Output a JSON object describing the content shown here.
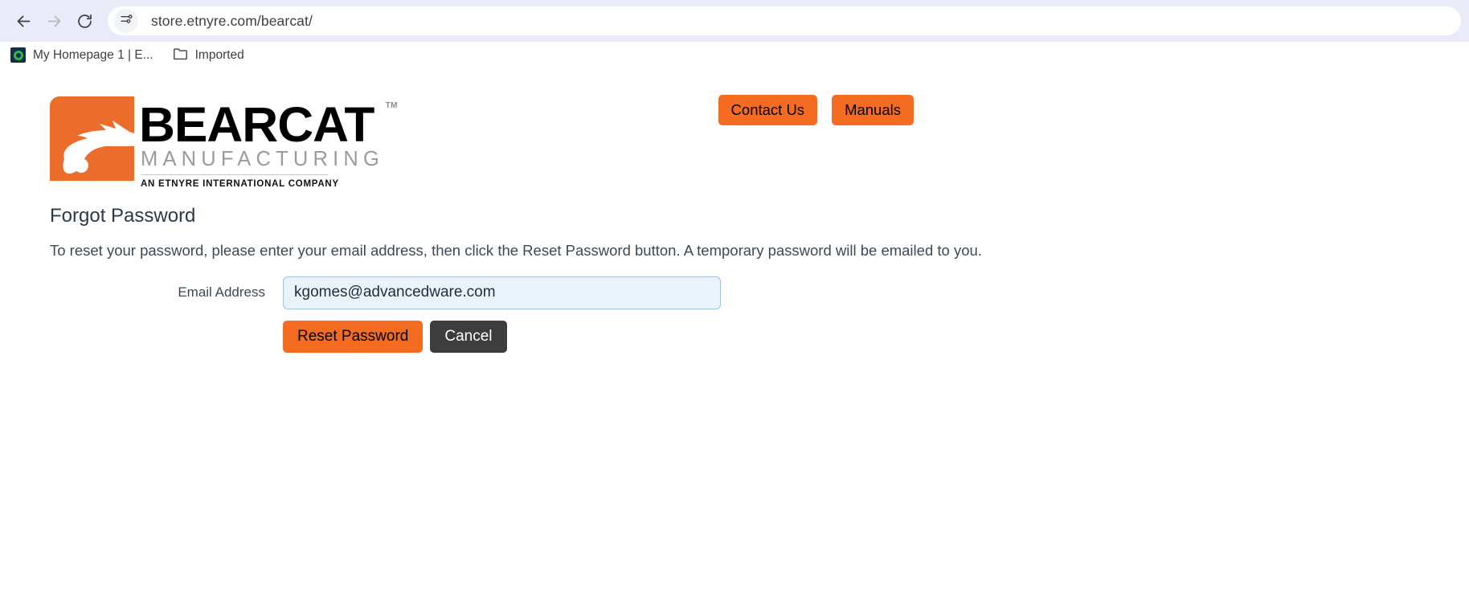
{
  "browser": {
    "back_icon": "back-arrow-icon",
    "forward_icon": "forward-arrow-icon",
    "reload_icon": "reload-icon",
    "site_settings_icon": "site-settings-tune-icon",
    "url": "store.etnyre.com/bearcat/",
    "bookmarks": [
      {
        "label": "My Homepage 1 | E...",
        "icon": "homepage-favicon"
      },
      {
        "label": "Imported",
        "icon": "folder-icon"
      }
    ]
  },
  "site": {
    "logo": {
      "mark_icon": "bearcat-head-icon",
      "wordmark": "BEARCAT",
      "trademark": "TM",
      "subtitle": "MANUFACTURING",
      "tagline": "AN ETNYRE INTERNATIONAL COMPANY"
    },
    "header_buttons": [
      {
        "label": "Contact Us"
      },
      {
        "label": "Manuals"
      }
    ]
  },
  "main": {
    "title": "Forgot Password",
    "instructions": "To reset your password, please enter your email address, then click the Reset Password button. A temporary password will be emailed to you.",
    "form": {
      "email_label": "Email Address",
      "email_value": "kgomes@advancedware.com",
      "email_placeholder": ""
    },
    "actions": {
      "submit_label": "Reset Password",
      "cancel_label": "Cancel"
    }
  },
  "colors": {
    "brand_orange": "#f36c22",
    "logo_orange": "#ec6c2b",
    "cancel_gray": "#3d3d3d",
    "toolbar_bg": "#e9ecf8",
    "input_bg": "#eaf2fb",
    "input_border": "#9dc3e6"
  }
}
